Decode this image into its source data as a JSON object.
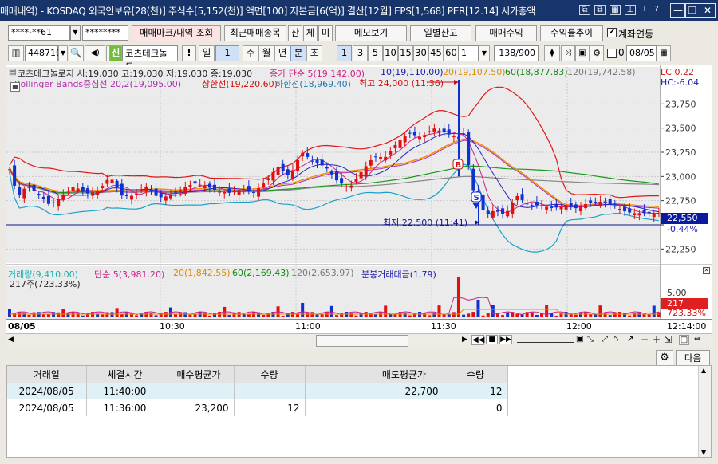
{
  "window": {
    "title": "매매내역) - KOSDAQ 외국인보유[28(천)] 주식수[5,152(천)] 액면[100] 자본금[6(억)] 결산[12월] EPS[1,568] PER[12.14] 시가총액",
    "win_minimize": "—",
    "win_restore": "❐",
    "win_close": "✕"
  },
  "toolbar1": {
    "account": "****-**61",
    "password": "********",
    "btn_trade_mark": "매매마크/내역 조회",
    "btn_recent": "최근매매종목",
    "btn_jan": "잔",
    "btn_che": "체",
    "btn_mi": "미",
    "btn_memo": "메모보기",
    "btn_daily": "일별잔고",
    "btn_profit": "매매수익",
    "btn_return": "수익률추이",
    "chk_account_link": "계좌연동"
  },
  "toolbar2": {
    "code": "448710",
    "sin": "신",
    "stock_name": "코츠테크놀로",
    "warn": "!",
    "period_il": "일",
    "period_num": "1",
    "ju": "주",
    "wol": "월",
    "nyeon": "년",
    "bun": "분",
    "cho": "초",
    "interval_sel": "1",
    "iv3": "3",
    "iv5": "5",
    "iv10": "10",
    "iv15": "15",
    "iv30": "30",
    "iv45": "45",
    "iv60": "60",
    "count_sel": "1",
    "count": "138/900",
    "zero": "0",
    "date": "08/05"
  },
  "chart": {
    "price_info": "코츠테크놀로지 시:19,030 고:19,030 저:19,030 종:19,030",
    "ma_close": "종가 단순 5(19,142.00)",
    "ma10": "10(19,110.00)",
    "ma20": "20(19,107.50)",
    "ma60": "60(18,877.83)",
    "ma120": "120(19,742.58)",
    "bb_center": "Bollinger Bands중심선 20,2(19,095.00)",
    "bb_upper": "상한선(19,220.60)",
    "bb_lower": "하한선(18,969.40)",
    "high_note": "최고 24,000 (11:36)",
    "low_note": "최저 22,500 (11:41)",
    "lc": "LC:0.22",
    "hc": "HC:-6.04",
    "price_axis": [
      "23,750",
      "23,500",
      "23,250",
      "23,000",
      "22,750",
      "22,500",
      "22,250"
    ],
    "current_price": "22,550",
    "current_change": "-0.44%",
    "buy_marker": "B",
    "sell_marker": "S",
    "vol_legend": "거래량(9,410.00)",
    "vol_ma5": "단순 5(3,981.20)",
    "vol_ma20": "20(1,842.55)",
    "vol_ma60": "60(2,169.43)",
    "vol_ma120": "120(2,653.97)",
    "vol_amount": "분봉거래대금(1,79)",
    "vol_last": "217주(723.33%)",
    "vol_axis": "5.00",
    "vol_current": "217",
    "vol_current_pct": "723.33%",
    "time_axis": [
      "08/05",
      "10:30",
      "11:00",
      "11:30",
      "12:00",
      "12:14:00"
    ]
  },
  "bottom": {
    "next_button": "다음"
  },
  "grid": {
    "headers": [
      "거래일",
      "체결시간",
      "매수평균가",
      "수량",
      "",
      "매도평균가",
      "수량"
    ],
    "rows": [
      [
        "2024/08/05",
        "11:40:00",
        "",
        "",
        "",
        "22,700",
        "12"
      ],
      [
        "2024/08/05",
        "11:36:00",
        "23,200",
        "12",
        "",
        "",
        "0"
      ]
    ]
  }
}
